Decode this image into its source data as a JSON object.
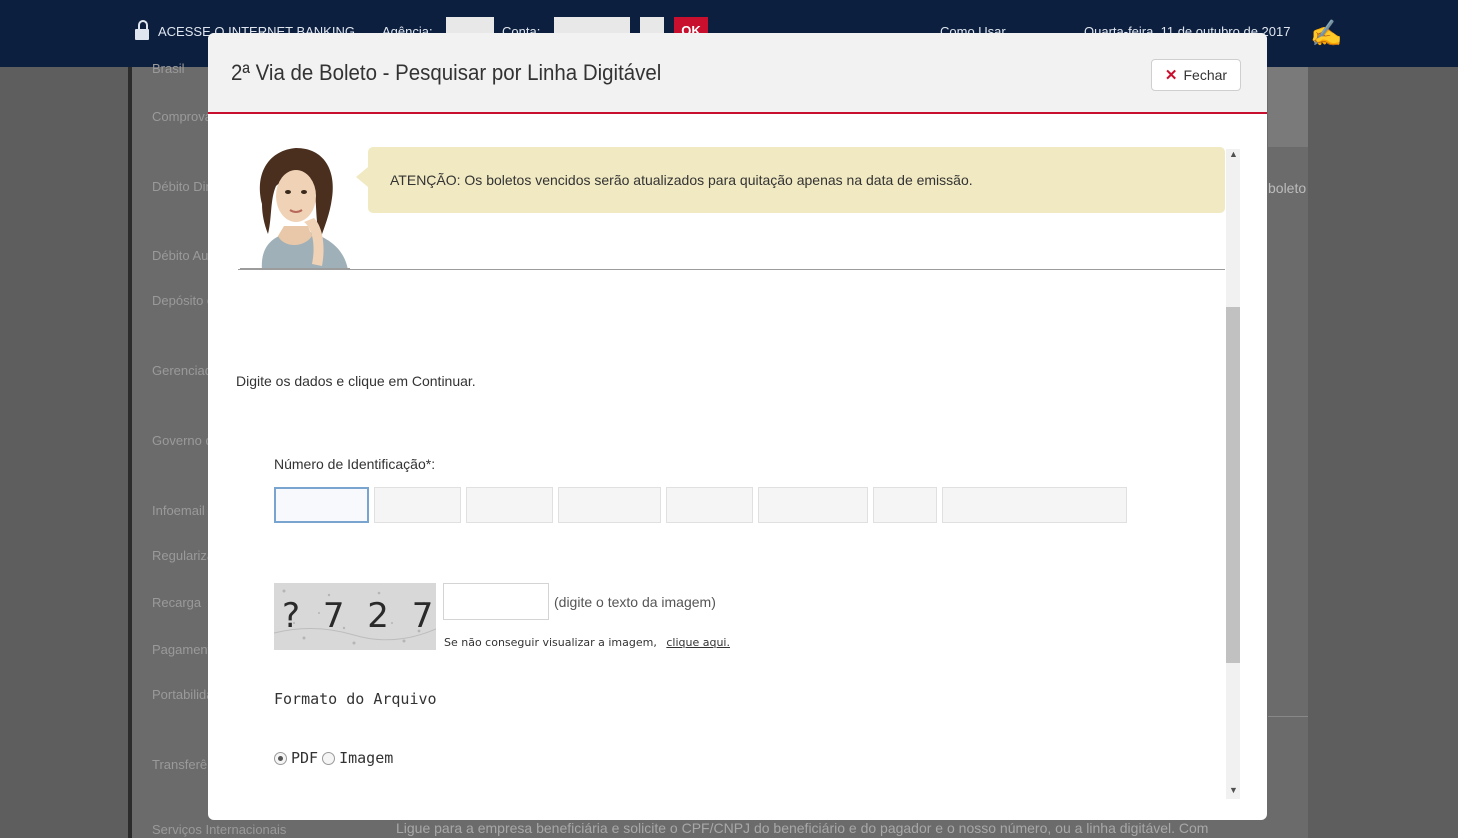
{
  "topbar": {
    "access_label": "ACESSE O INTERNET BANKING",
    "agency_label": "Agência:",
    "account_label": "Conta:",
    "ok_label": "OK",
    "how_to_use": "Como Usar",
    "date": "Quarta-feira, 11 de outubro de 2017"
  },
  "side_nav": {
    "items": [
      "Brasil",
      "Comprovante de Documentos",
      "Débito Direto Autorizado - DDA",
      "Débito Automático",
      "Depósito em Celular",
      "Gerenciador Financeiro",
      "Governo do Rio de Janeiro",
      "Infoemail",
      "Regularização",
      "Recarga",
      "Pagamentos",
      "Portabilidade de Crédito",
      "Transferências e Depósitos",
      "Serviços Internacionais"
    ]
  },
  "background": {
    "right_text": "boleto",
    "bottom_text": "Ligue para a empresa beneficiária e solicite o CPF/CNPJ do beneficiário e do pagador e o nosso número, ou a linha digitável. Com"
  },
  "modal": {
    "title": "2ª Via de Boleto - Pesquisar por Linha Digitável",
    "close_label": "Fechar",
    "close_icon": "✕",
    "notice": "ATENÇÃO: Os boletos vencidos serão atualizados para quitação apenas na data de emissão.",
    "instructions": "Digite os dados e clique em Continuar.",
    "id_label": "Número de Identificação*:",
    "id_fields": [
      "",
      "",
      "",
      "",
      "",
      "",
      "",
      ""
    ],
    "captcha": {
      "text": "? 7 2 7",
      "input_value": "",
      "hint": "(digite o texto da imagem)",
      "help_text": "Se não conseguir visualizar a imagem,",
      "help_link": "clique aqui."
    },
    "format_label": "Formato do Arquivo",
    "format_options": [
      {
        "label": "PDF",
        "checked": true
      },
      {
        "label": "Imagem",
        "checked": false
      }
    ]
  },
  "colors": {
    "accent": "#c8102e",
    "topbar_bg": "#0d1f3f",
    "notice_bg": "#f0e9c2"
  }
}
